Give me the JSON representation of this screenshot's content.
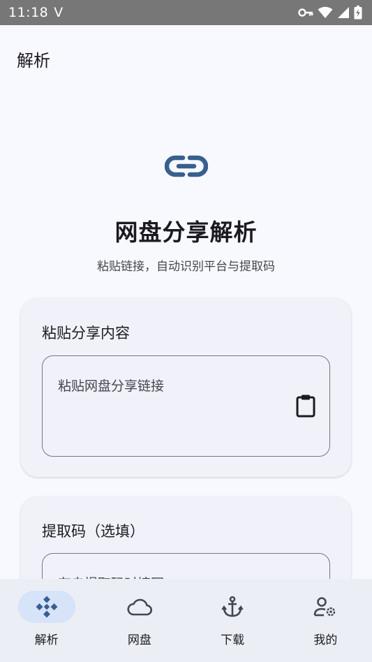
{
  "status_bar": {
    "time": "11:18",
    "carrier_glyph": "V",
    "icons": [
      "vpn-key-icon",
      "wifi-icon",
      "signal-icon",
      "battery-charging-icon"
    ]
  },
  "app_bar": {
    "title": "解析"
  },
  "hero": {
    "icon": "link-icon",
    "title": "网盘分享解析",
    "subtitle": "粘贴链接，自动识别平台与提取码"
  },
  "share_card": {
    "title": "粘贴分享内容",
    "placeholder": "粘贴网盘分享链接",
    "icon": "clipboard-icon"
  },
  "code_card": {
    "title": "提取码（选填）",
    "placeholder": "有自提取码时填写"
  },
  "bottom_nav": {
    "items": [
      {
        "label": "解析",
        "icon": "parse-icon",
        "active": true
      },
      {
        "label": "网盘",
        "icon": "cloud-icon",
        "active": false
      },
      {
        "label": "下载",
        "icon": "anchor-icon",
        "active": false
      },
      {
        "label": "我的",
        "icon": "user-settings-icon",
        "active": false
      }
    ]
  },
  "colors": {
    "accent": "#385f8f",
    "active_nav_bg": "#d6e3f8",
    "background": "#f8f9fe",
    "card_bg": "#f1f2f9"
  }
}
